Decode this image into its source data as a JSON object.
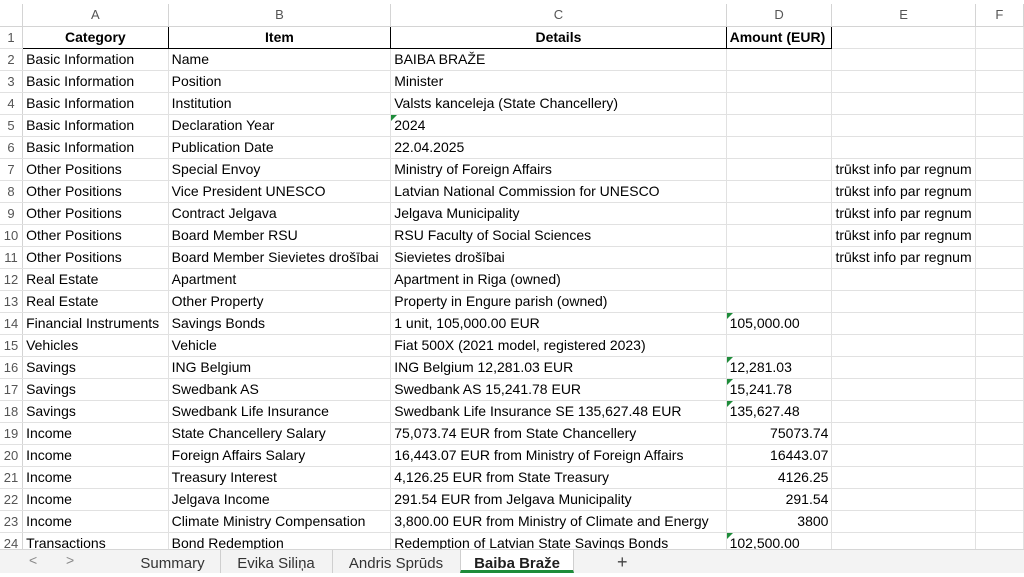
{
  "columns": [
    "A",
    "B",
    "C",
    "D",
    "E",
    "F"
  ],
  "headers": {
    "row_num": "1",
    "category": "Category",
    "item": "Item",
    "details": "Details",
    "amount": "Amount (EUR)"
  },
  "rows": [
    {
      "n": "2",
      "cat": "Basic Information",
      "item": "Name",
      "details": "BAIBA BRAŽE",
      "amount": "",
      "e": ""
    },
    {
      "n": "3",
      "cat": "Basic Information",
      "item": "Position",
      "details": "Minister",
      "amount": "",
      "e": ""
    },
    {
      "n": "4",
      "cat": "Basic Information",
      "item": "Institution",
      "details": "Valsts kanceleja (State Chancellery)",
      "amount": "",
      "e": ""
    },
    {
      "n": "5",
      "cat": "Basic Information",
      "item": "Declaration Year",
      "details": "2024",
      "amount": "",
      "e": ""
    },
    {
      "n": "6",
      "cat": "Basic Information",
      "item": "Publication Date",
      "details": "22.04.2025",
      "amount": "",
      "e": ""
    },
    {
      "n": "7",
      "cat": "Other Positions",
      "item": "Special Envoy",
      "details": "Ministry of Foreign Affairs",
      "amount": "",
      "e": "trūkst info par regnum"
    },
    {
      "n": "8",
      "cat": "Other Positions",
      "item": "Vice President UNESCO",
      "details": "Latvian National Commission for UNESCO",
      "amount": "",
      "e": "trūkst info par regnum"
    },
    {
      "n": "9",
      "cat": "Other Positions",
      "item": "Contract Jelgava",
      "details": "Jelgava Municipality",
      "amount": "",
      "e": "trūkst info par regnum"
    },
    {
      "n": "10",
      "cat": "Other Positions",
      "item": "Board Member RSU",
      "details": "RSU Faculty of Social Sciences",
      "amount": "",
      "e": "trūkst info par regnum"
    },
    {
      "n": "11",
      "cat": "Other Positions",
      "item": "Board Member Sievietes drošībai",
      "details": "Sievietes drošībai",
      "amount": "",
      "e": "trūkst info par regnum"
    },
    {
      "n": "12",
      "cat": "Real Estate",
      "item": "Apartment",
      "details": "Apartment in Riga (owned)",
      "amount": "",
      "e": ""
    },
    {
      "n": "13",
      "cat": "Real Estate",
      "item": "Other Property",
      "details": "Property in Engure parish (owned)",
      "amount": "",
      "e": ""
    },
    {
      "n": "14",
      "cat": "Financial Instruments",
      "item": "Savings Bonds",
      "details": "1 unit, 105,000.00 EUR",
      "amount": "105,000.00",
      "e": ""
    },
    {
      "n": "15",
      "cat": "Vehicles",
      "item": "Vehicle",
      "details": "Fiat 500X (2021 model, registered 2023)",
      "amount": "",
      "e": ""
    },
    {
      "n": "16",
      "cat": "Savings",
      "item": "ING Belgium",
      "details": "ING Belgium 12,281.03 EUR",
      "amount": "12,281.03",
      "e": ""
    },
    {
      "n": "17",
      "cat": "Savings",
      "item": "Swedbank AS",
      "details": "Swedbank AS 15,241.78 EUR",
      "amount": "15,241.78",
      "e": ""
    },
    {
      "n": "18",
      "cat": "Savings",
      "item": "Swedbank Life Insurance",
      "details": "Swedbank Life Insurance SE 135,627.48 EUR",
      "amount": "135,627.48",
      "e": ""
    },
    {
      "n": "19",
      "cat": "Income",
      "item": "State Chancellery Salary",
      "details": "75,073.74 EUR from State Chancellery",
      "amount": "75073.74",
      "e": ""
    },
    {
      "n": "20",
      "cat": "Income",
      "item": "Foreign Affairs Salary",
      "details": "16,443.07 EUR from Ministry of Foreign Affairs",
      "amount": "16443.07",
      "e": ""
    },
    {
      "n": "21",
      "cat": "Income",
      "item": "Treasury Interest",
      "details": "4,126.25 EUR from State Treasury",
      "amount": "4126.25",
      "e": ""
    },
    {
      "n": "22",
      "cat": "Income",
      "item": "Jelgava Income",
      "details": "291.54 EUR from Jelgava Municipality",
      "amount": "291.54",
      "e": ""
    },
    {
      "n": "23",
      "cat": "Income",
      "item": "Climate Ministry Compensation",
      "details": "3,800.00 EUR from Ministry of Climate and Energy",
      "amount": "3800",
      "e": ""
    },
    {
      "n": "24",
      "cat": "Transactions",
      "item": "Bond Redemption",
      "details": "Redemption of Latvian State Savings Bonds",
      "amount": "102,500.00",
      "e": ""
    }
  ],
  "text_marked_rows": [
    "5",
    "14",
    "16",
    "17",
    "18",
    "24"
  ],
  "tabs": [
    "Summary",
    "Evika Siliņa",
    "Andris Sprūds",
    "Baiba Braže"
  ],
  "active_tab": "Baiba Braže",
  "add_tab": "+",
  "nav": {
    "prev": "<",
    "next": ">"
  },
  "colors": {
    "marker": "#1e8c3a",
    "gridline": "#e1e1e1"
  }
}
